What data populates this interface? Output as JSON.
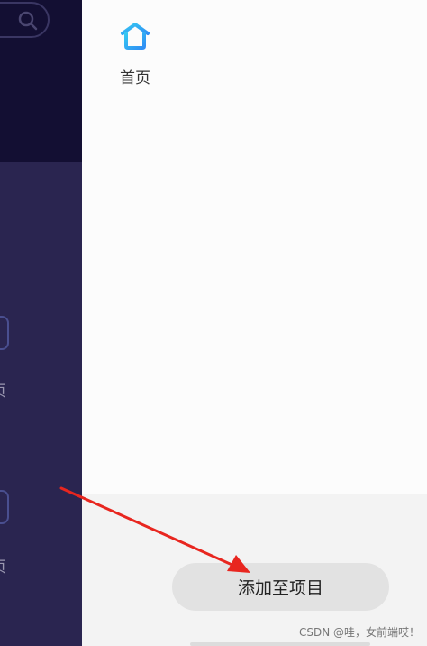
{
  "left_strip": {
    "item_labels": [
      "页",
      "页"
    ]
  },
  "menu": {
    "home": {
      "label": "首页",
      "icon": "home-icon"
    }
  },
  "actions": {
    "add_to_project": "添加至项目"
  },
  "watermark": "CSDN @哇，女前端哎！",
  "colors": {
    "accent_gradient": [
      "#36c9f2",
      "#2f8ef4"
    ],
    "annotation_arrow": "#e8261f",
    "overlay_dark": "#130f33",
    "overlay": "#2a2550"
  }
}
